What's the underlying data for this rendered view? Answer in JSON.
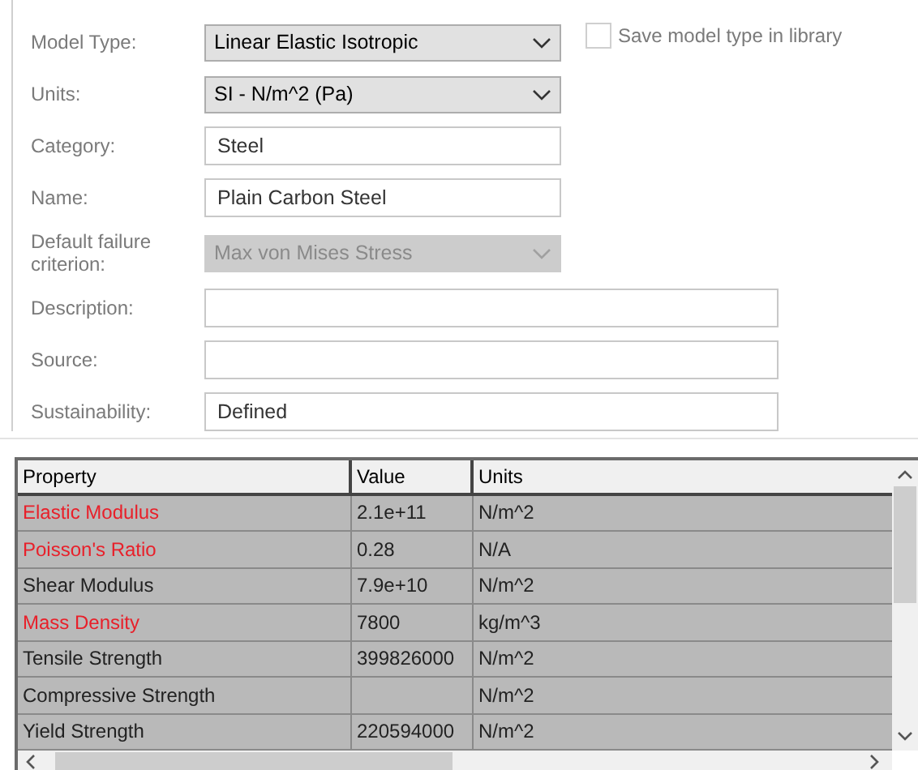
{
  "form": [
    {
      "label": "Model Type:",
      "kind": "select",
      "value": "Linear Elastic Isotropic",
      "disabled": false,
      "wide": false
    },
    {
      "label": "Units:",
      "kind": "select",
      "value": "SI - N/m^2 (Pa)",
      "disabled": false,
      "wide": false
    },
    {
      "label": "Category:",
      "kind": "text",
      "value": "Steel",
      "wide": false
    },
    {
      "label": "Name:",
      "kind": "text",
      "value": "Plain Carbon Steel",
      "wide": false
    },
    {
      "label": "Default failure criterion:",
      "kind": "select",
      "value": "Max von Mises Stress",
      "disabled": true,
      "wide": false
    },
    {
      "label": "Description:",
      "kind": "text",
      "wide": true
    },
    {
      "label": "Source:",
      "kind": "text",
      "wide": true
    },
    {
      "label": "Sustainability:",
      "kind": "text",
      "value": "Defined",
      "wide": true
    }
  ],
  "save_checkbox": {
    "label": "Save model type in library",
    "checked": false
  },
  "table": {
    "columns": [
      "Property",
      "Value",
      "Units"
    ],
    "rows": [
      {
        "property": "Elastic Modulus",
        "value": "2.1e+11",
        "units": "N/m^2",
        "required": true
      },
      {
        "property": "Poisson's Ratio",
        "value": "0.28",
        "units": "N/A",
        "required": true
      },
      {
        "property": "Shear Modulus",
        "value": "7.9e+10",
        "units": "N/m^2",
        "required": false
      },
      {
        "property": "Mass Density",
        "value": "7800",
        "units": "kg/m^3",
        "required": true
      },
      {
        "property": "Tensile Strength",
        "value": "399826000",
        "units": "N/m^2",
        "required": false
      },
      {
        "property": "Compressive Strength",
        "units": "N/m^2",
        "required": false
      },
      {
        "property": "Yield Strength",
        "value": "220594000",
        "units": "N/m^2",
        "required": false
      }
    ]
  }
}
